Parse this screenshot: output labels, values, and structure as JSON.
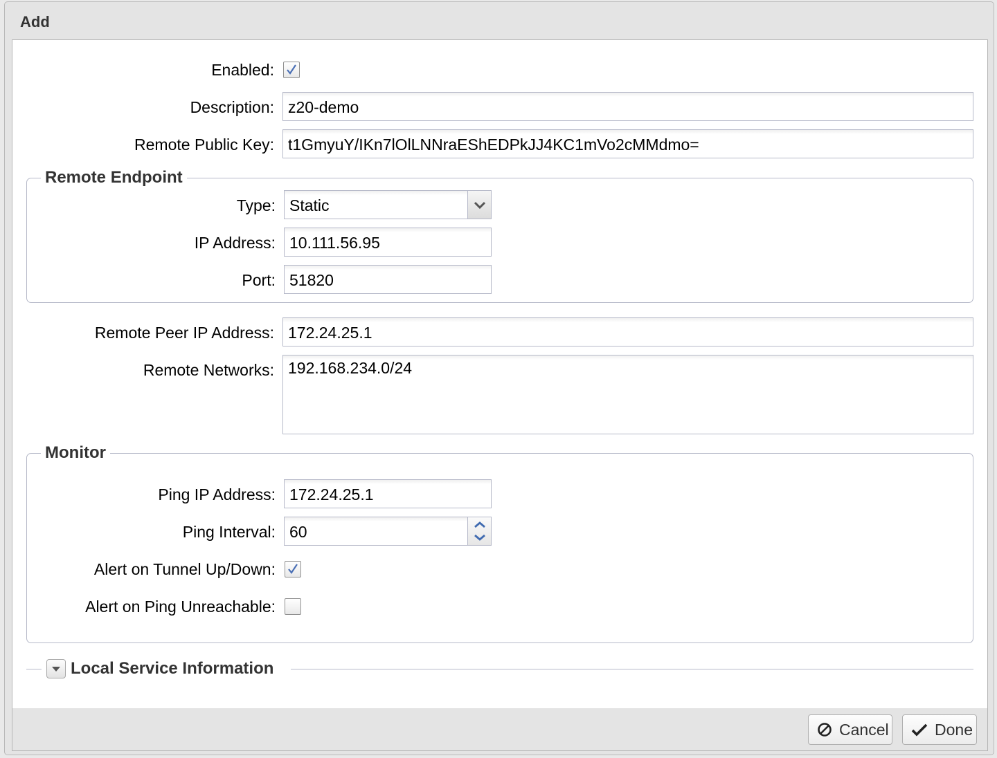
{
  "window": {
    "title": "Add"
  },
  "form": {
    "enabled": {
      "label": "Enabled:",
      "checked": true
    },
    "description": {
      "label": "Description:",
      "value": "z20-demo"
    },
    "remote_public_key": {
      "label": "Remote Public Key:",
      "value": "t1GmyuY/IKn7lOlLNNraEShEDPkJJ4KC1mVo2cMMdmo="
    },
    "remote_endpoint": {
      "legend": "Remote Endpoint",
      "type": {
        "label": "Type:",
        "value": "Static"
      },
      "ip_address": {
        "label": "IP Address:",
        "value": "10.111.56.95"
      },
      "port": {
        "label": "Port:",
        "value": "51820"
      }
    },
    "remote_peer_ip": {
      "label": "Remote Peer IP Address:",
      "value": "172.24.25.1"
    },
    "remote_networks": {
      "label": "Remote Networks:",
      "value": "192.168.234.0/24"
    },
    "monitor": {
      "legend": "Monitor",
      "ping_ip": {
        "label": "Ping IP Address:",
        "value": "172.24.25.1"
      },
      "ping_interval": {
        "label": "Ping Interval:",
        "value": "60"
      },
      "alert_tunnel": {
        "label": "Alert on Tunnel Up/Down:",
        "checked": true
      },
      "alert_ping": {
        "label": "Alert on Ping Unreachable:",
        "checked": false
      }
    },
    "local_service": {
      "legend": "Local Service Information"
    }
  },
  "footer": {
    "cancel_label": "Cancel",
    "done_label": "Done"
  }
}
